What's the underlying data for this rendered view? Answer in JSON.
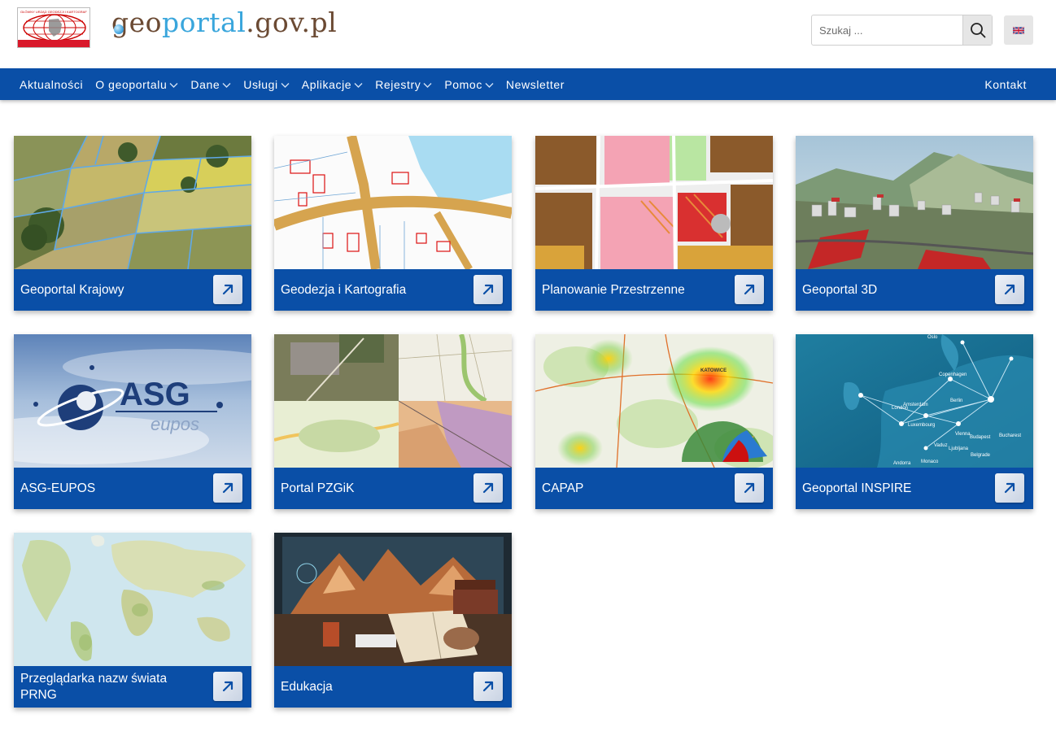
{
  "header": {
    "gugik_logo_text": "GŁÓWNY URZĄD GEODEZJI I KARTOGRAFII",
    "site_logo": {
      "part1": "geo",
      "part2": "portal",
      "part3": ".gov.pl"
    },
    "search": {
      "placeholder": "Szukaj ...",
      "value": "",
      "icon": "search-icon"
    },
    "language": {
      "icon": "uk-flag-icon"
    }
  },
  "nav": {
    "items": [
      {
        "label": "Aktualności",
        "has_dropdown": false
      },
      {
        "label": "O geoportalu",
        "has_dropdown": true
      },
      {
        "label": "Dane",
        "has_dropdown": true
      },
      {
        "label": "Usługi",
        "has_dropdown": true
      },
      {
        "label": "Aplikacje",
        "has_dropdown": true
      },
      {
        "label": "Rejestry",
        "has_dropdown": true
      },
      {
        "label": "Pomoc",
        "has_dropdown": true
      },
      {
        "label": "Newsletter",
        "has_dropdown": false
      }
    ],
    "contact": "Kontakt"
  },
  "tiles": [
    {
      "label": "Geoportal Krajowy",
      "thumb": "aerial-fields"
    },
    {
      "label": "Geodezja i Kartografia",
      "thumb": "cadastral-map"
    },
    {
      "label": "Planowanie Przestrzenne",
      "thumb": "zoning-plan"
    },
    {
      "label": "Geoportal 3D",
      "thumb": "3d-terrain"
    },
    {
      "label": "ASG-EUPOS",
      "thumb": "asg-eupos-logo"
    },
    {
      "label": "Portal PZGiK",
      "thumb": "map-collage"
    },
    {
      "label": "CAPAP",
      "thumb": "heatmap"
    },
    {
      "label": "Geoportal INSPIRE",
      "thumb": "europe-network"
    },
    {
      "label": "Przeglądarka nazw świata PRNG",
      "thumb": "world-map"
    },
    {
      "label": "Edukacja",
      "thumb": "education-desk"
    }
  ],
  "thumb_texts": {
    "asg_main": "ASG",
    "asg_sub": "eupos",
    "capap_city": "KATOWICE",
    "inspire_cities": [
      "Oslo",
      "Copenhagen",
      "Berlin",
      "London",
      "Amsterdam",
      "Luxembourg",
      "Vienna",
      "Budapest",
      "Bucharest",
      "Ljubljana",
      "Belgrade",
      "Vaduz",
      "Andorra",
      "Monaco"
    ]
  },
  "colors": {
    "brand_blue": "#0a4fa7",
    "logo_brown": "#6b4a33",
    "logo_light_blue": "#3aa6dc"
  }
}
